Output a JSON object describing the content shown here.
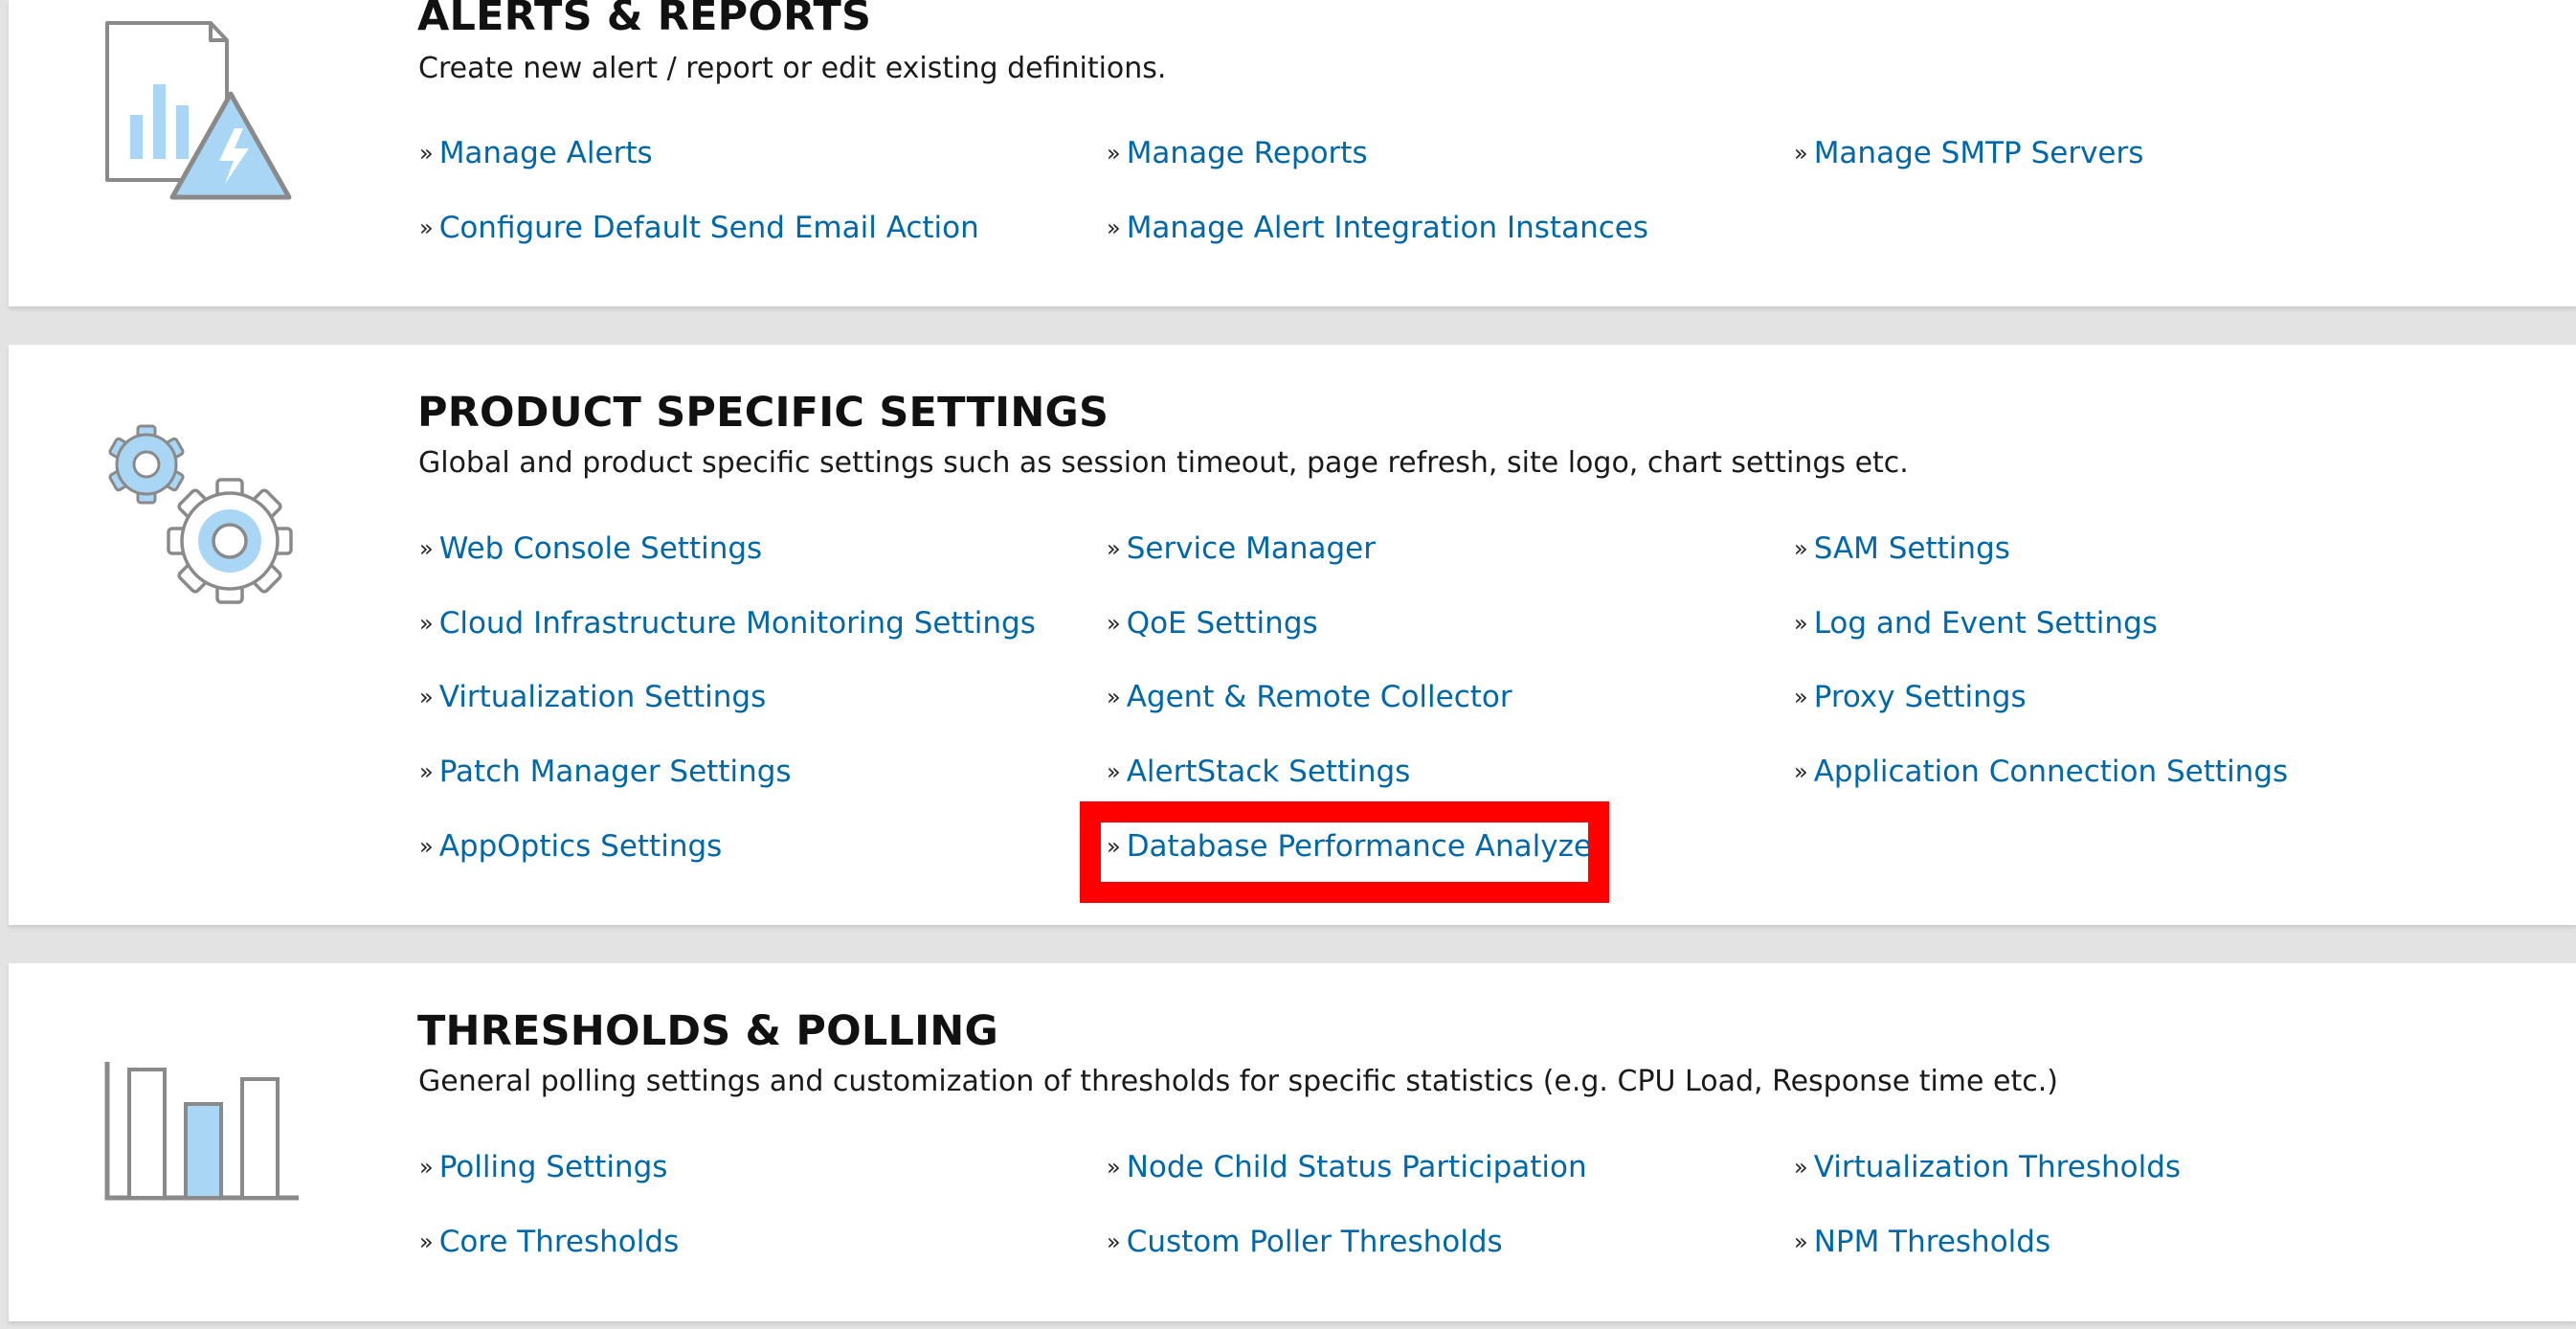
{
  "sections": [
    {
      "title": "ALERTS & REPORTS",
      "description": "Create new alert / report or edit existing definitions.",
      "icon": "report-alert-icon",
      "links": [
        "Manage Alerts",
        "Manage Reports",
        "Manage SMTP Servers",
        "Configure Default Send Email Action",
        "Manage Alert Integration Instances"
      ]
    },
    {
      "title": "PRODUCT SPECIFIC SETTINGS",
      "description": "Global and product specific settings such as session timeout, page refresh, site logo, chart settings etc.",
      "icon": "gears-icon",
      "links": [
        "Web Console Settings",
        "Service Manager",
        "SAM Settings",
        "Cloud Infrastructure Monitoring Settings",
        "QoE Settings",
        "Log and Event Settings",
        "Virtualization Settings",
        "Agent & Remote Collector",
        "Proxy Settings",
        "Patch Manager Settings",
        "AlertStack Settings",
        "Application Connection Settings",
        "AppOptics Settings",
        "Database Performance Analyzer"
      ],
      "highlighted_link": "Database Performance Analyzer"
    },
    {
      "title": "THRESHOLDS & POLLING",
      "description": "General polling settings and customization of thresholds for specific statistics (e.g. CPU Load, Response time etc.)",
      "icon": "bar-chart-icon",
      "links": [
        "Polling Settings",
        "Node Child Status Participation",
        "Virtualization Thresholds",
        "Core Thresholds",
        "Custom Poller Thresholds",
        "NPM Thresholds"
      ]
    }
  ],
  "link_marker": "»",
  "colors": {
    "link": "#0068a8",
    "icon_fill": "#a9d6f5",
    "icon_stroke": "#8a8a8a",
    "highlight": "#ff0000",
    "page_background": "#e3e3e3"
  }
}
